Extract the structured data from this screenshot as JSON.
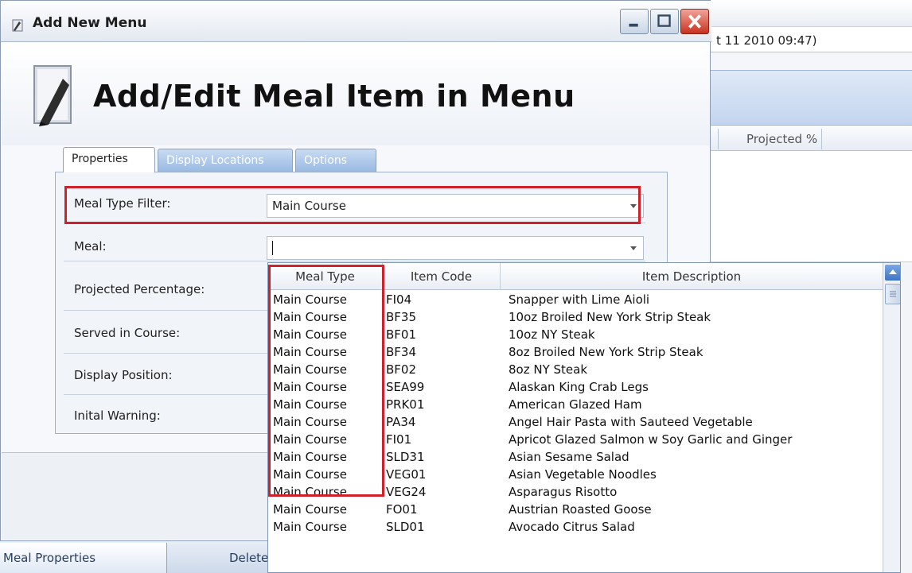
{
  "window": {
    "title": "Add New Menu",
    "header_title": "Add/Edit Meal Item in Menu"
  },
  "background_app": {
    "timestamp_fragment": "t 11 2010 09:47)",
    "column_header": "Projected %"
  },
  "tabs": [
    {
      "label": "Properties",
      "active": true
    },
    {
      "label": "Display Locations",
      "active": false
    },
    {
      "label": "Options",
      "active": false
    }
  ],
  "properties": {
    "meal_type_filter": {
      "label": "Meal Type Filter:",
      "value": "Main Course"
    },
    "meal": {
      "label": "Meal:",
      "value": ""
    },
    "projected_percentage": {
      "label": "Projected Percentage:"
    },
    "served_in_course": {
      "label": "Served in Course:"
    },
    "display_position": {
      "label": "Display Position:"
    },
    "initial_warning": {
      "label": "Inital Warning:"
    }
  },
  "dropdown": {
    "columns": [
      "Meal Type",
      "Item Code",
      "Item Description"
    ],
    "rows": [
      {
        "type": "Main Course",
        "code": "FI04",
        "desc": "Snapper with Lime Aioli"
      },
      {
        "type": "Main Course",
        "code": "BF35",
        "desc": "10oz Broiled New York Strip Steak"
      },
      {
        "type": "Main Course",
        "code": "BF01",
        "desc": "10oz NY Steak"
      },
      {
        "type": "Main Course",
        "code": "BF34",
        "desc": "8oz Broiled New York Strip Steak"
      },
      {
        "type": "Main Course",
        "code": "BF02",
        "desc": "8oz NY Steak"
      },
      {
        "type": "Main Course",
        "code": "SEA99",
        "desc": "Alaskan King Crab Legs"
      },
      {
        "type": "Main Course",
        "code": "PRK01",
        "desc": "American Glazed Ham"
      },
      {
        "type": "Main Course",
        "code": "PA34",
        "desc": "Angel Hair Pasta with Sauteed Vegetable"
      },
      {
        "type": "Main Course",
        "code": "FI01",
        "desc": "Apricot Glazed Salmon w Soy Garlic and Ginger"
      },
      {
        "type": "Main Course",
        "code": "SLD31",
        "desc": "Asian Sesame Salad"
      },
      {
        "type": "Main Course",
        "code": "VEG01",
        "desc": "Asian Vegetable Noodles"
      },
      {
        "type": "Main Course",
        "code": "VEG24",
        "desc": "Asparagus Risotto"
      },
      {
        "type": "Main Course",
        "code": "FO01",
        "desc": "Austrian Roasted Goose"
      },
      {
        "type": "Main Course",
        "code": "SLD01",
        "desc": "Avocado Citrus Salad"
      }
    ]
  },
  "bottom_tabs": {
    "meal_properties": "Meal Properties",
    "delete": "Delete"
  },
  "colors": {
    "highlight": "#d0202a",
    "tab_inactive": "#98b8e2",
    "scroll": "#3d74c6"
  }
}
